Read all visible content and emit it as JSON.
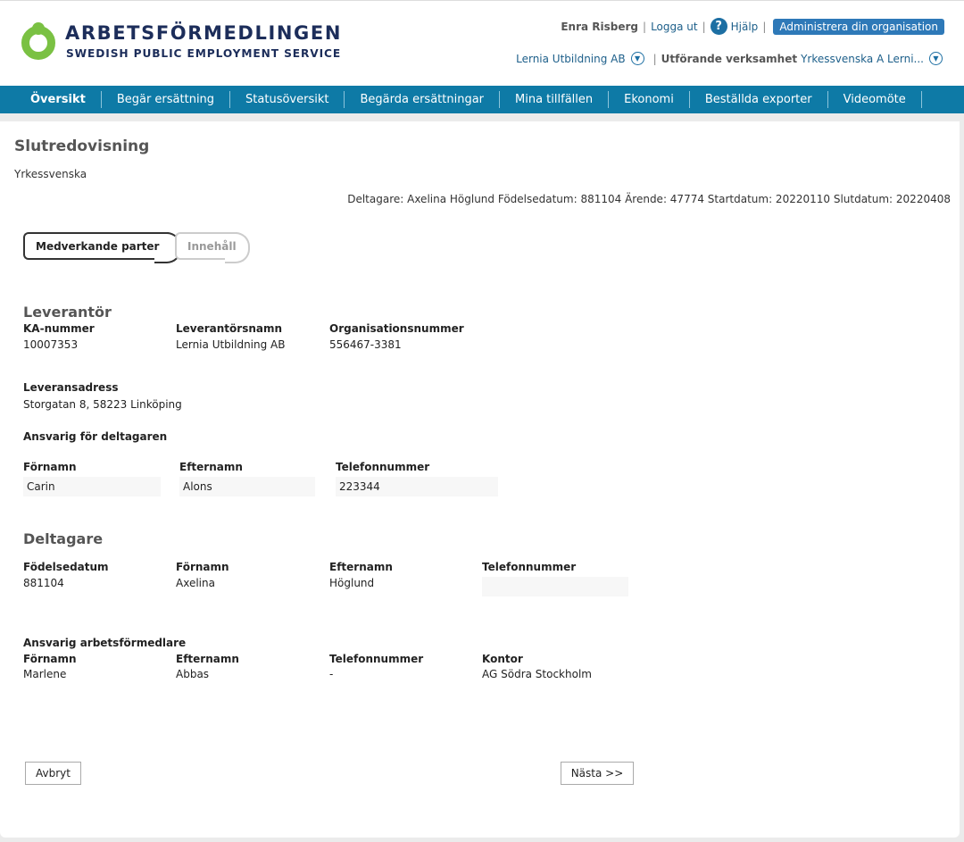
{
  "header": {
    "logo_title": "ARBETSFÖRMEDLINGEN",
    "logo_subtitle": "SWEDISH PUBLIC EMPLOYMENT SERVICE",
    "user_name": "Enra Risberg",
    "logout": "Logga ut",
    "help": "Hjälp",
    "admin": "Administrera din organisation",
    "org_selector": "Lernia Utbildning AB",
    "verksamhet_label": "Utförande verksamhet",
    "verksamhet_value": "Yrkessvenska A Lerni..."
  },
  "nav": [
    "Översikt",
    "Begär ersättning",
    "Statusöversikt",
    "Begärda ersättningar",
    "Mina tillfällen",
    "Ekonomi",
    "Beställda exporter",
    "Videomöte"
  ],
  "page": {
    "title": "Slutredovisning",
    "subtitle": "Yrkessvenska",
    "info_line": "Deltagare: Axelina Höglund Födelsedatum: 881104 Ärende: 47774 Startdatum: 20220110 Slutdatum: 20220408"
  },
  "steps": {
    "step1": "Medverkande parter",
    "step2": "Innehåll"
  },
  "leverantor": {
    "title": "Leverantör",
    "ka_label": "KA-nummer",
    "ka_value": "10007353",
    "namn_label": "Leverantörsnamn",
    "namn_value": "Lernia Utbildning AB",
    "org_label": "Organisationsnummer",
    "org_value": "556467-3381",
    "adress_label": "Leveransadress",
    "adress_value": "Storgatan 8, 58223 Linköping",
    "ansvarig_label": "Ansvarig för deltagaren",
    "fornamn_label": "Förnamn",
    "fornamn_value": "Carin",
    "efternamn_label": "Efternamn",
    "efternamn_value": "Alons",
    "tel_label": "Telefonnummer",
    "tel_value": "223344"
  },
  "deltagare": {
    "title": "Deltagare",
    "fodelse_label": "Födelsedatum",
    "fodelse_value": "881104",
    "fornamn_label": "Förnamn",
    "fornamn_value": "Axelina",
    "efternamn_label": "Efternamn",
    "efternamn_value": "Höglund",
    "tel_label": "Telefonnummer",
    "tel_value": ""
  },
  "arbetsformedlare": {
    "title": "Ansvarig arbetsförmedlare",
    "fornamn_label": "Förnamn",
    "fornamn_value": "Marlene",
    "efternamn_label": "Efternamn",
    "efternamn_value": "Abbas",
    "tel_label": "Telefonnummer",
    "tel_value": "-",
    "kontor_label": "Kontor",
    "kontor_value": "AG Södra Stockholm"
  },
  "buttons": {
    "cancel": "Avbryt",
    "next": "Nästa >>"
  }
}
